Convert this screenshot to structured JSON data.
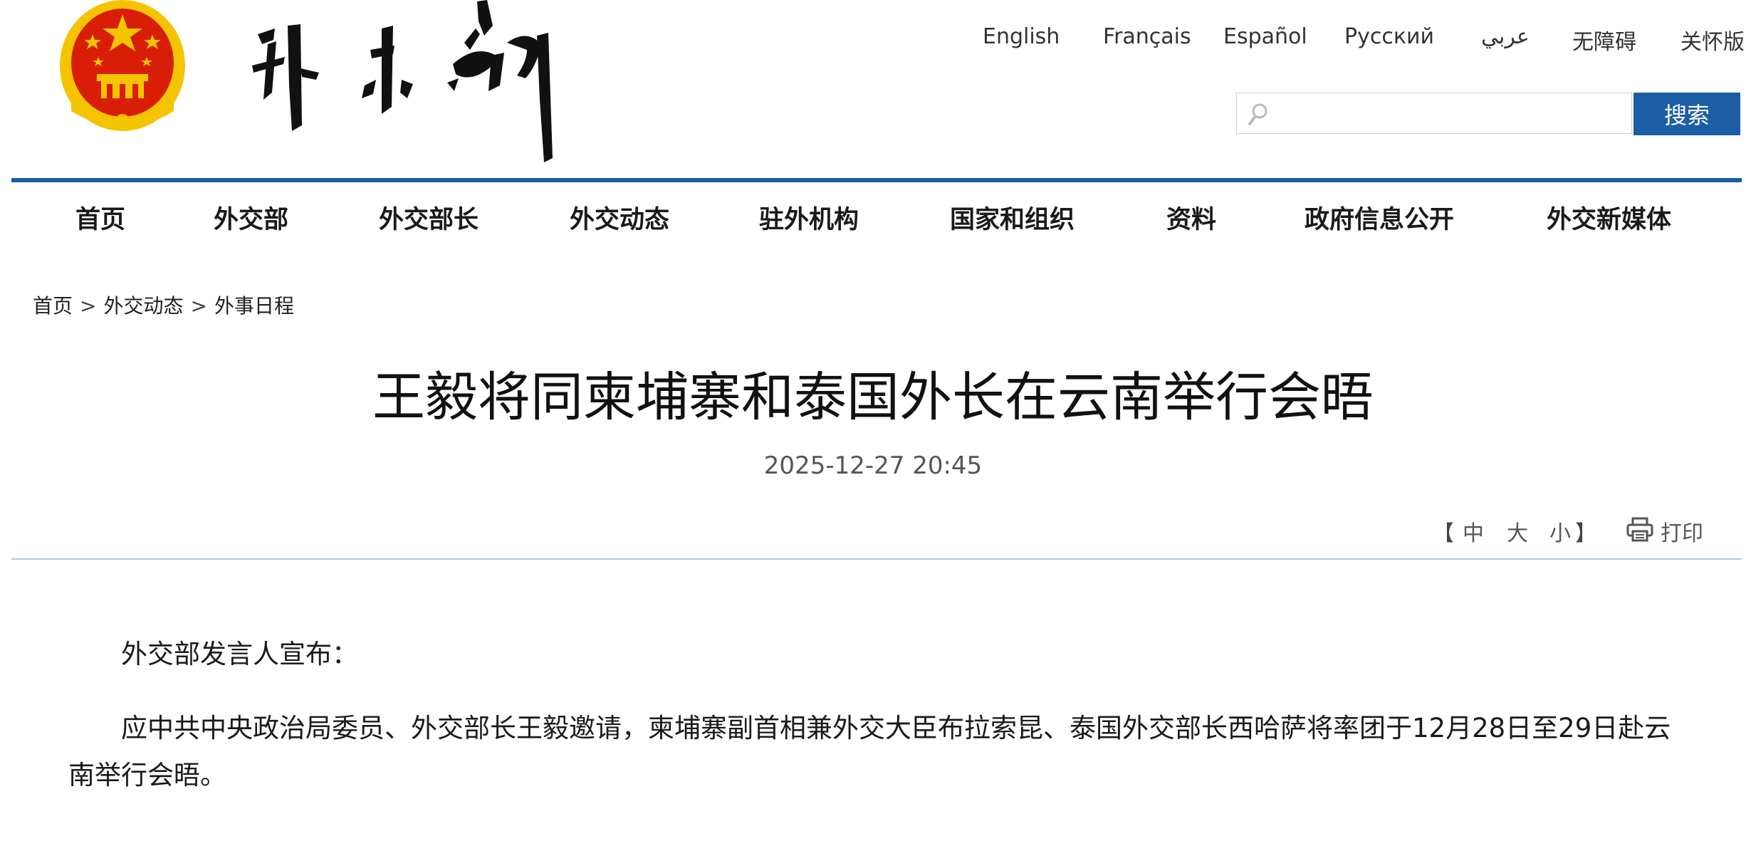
{
  "header": {
    "languages": [
      "English",
      "Français",
      "Español",
      "Русский",
      "عربي",
      "无障碍",
      "关怀版"
    ],
    "search": {
      "placeholder": "",
      "button_label": "搜索"
    }
  },
  "nav": {
    "items": [
      "首页",
      "外交部",
      "外交部长",
      "外交动态",
      "驻外机构",
      "国家和组织",
      "资料",
      "政府信息公开",
      "外交新媒体"
    ]
  },
  "breadcrumb": {
    "items": [
      "首页",
      "外交动态",
      "外事日程"
    ],
    "separator": ">"
  },
  "article": {
    "title": "王毅将同柬埔寨和泰国外长在云南举行会晤",
    "datetime": "2025-12-27 20:45",
    "font_size_controls": {
      "open": "【",
      "medium": "中",
      "large": "大",
      "small": "小",
      "close": "】"
    },
    "print_label": "打印",
    "paragraphs": [
      "外交部发言人宣布：",
      "应中共中央政治局委员、外交部长王毅邀请，柬埔寨副首相兼外交大臣布拉索昆、泰国外交部长西哈萨将率团于12月28日至29日赴云南举行会晤。"
    ]
  },
  "colors": {
    "brand_blue": "#1c5ea6",
    "divider_light_blue": "#a8cbe8",
    "emblem_red": "#d81e06",
    "emblem_gold": "#f5c400"
  },
  "icons": [
    "national-emblem-icon",
    "search-icon",
    "print-icon"
  ]
}
